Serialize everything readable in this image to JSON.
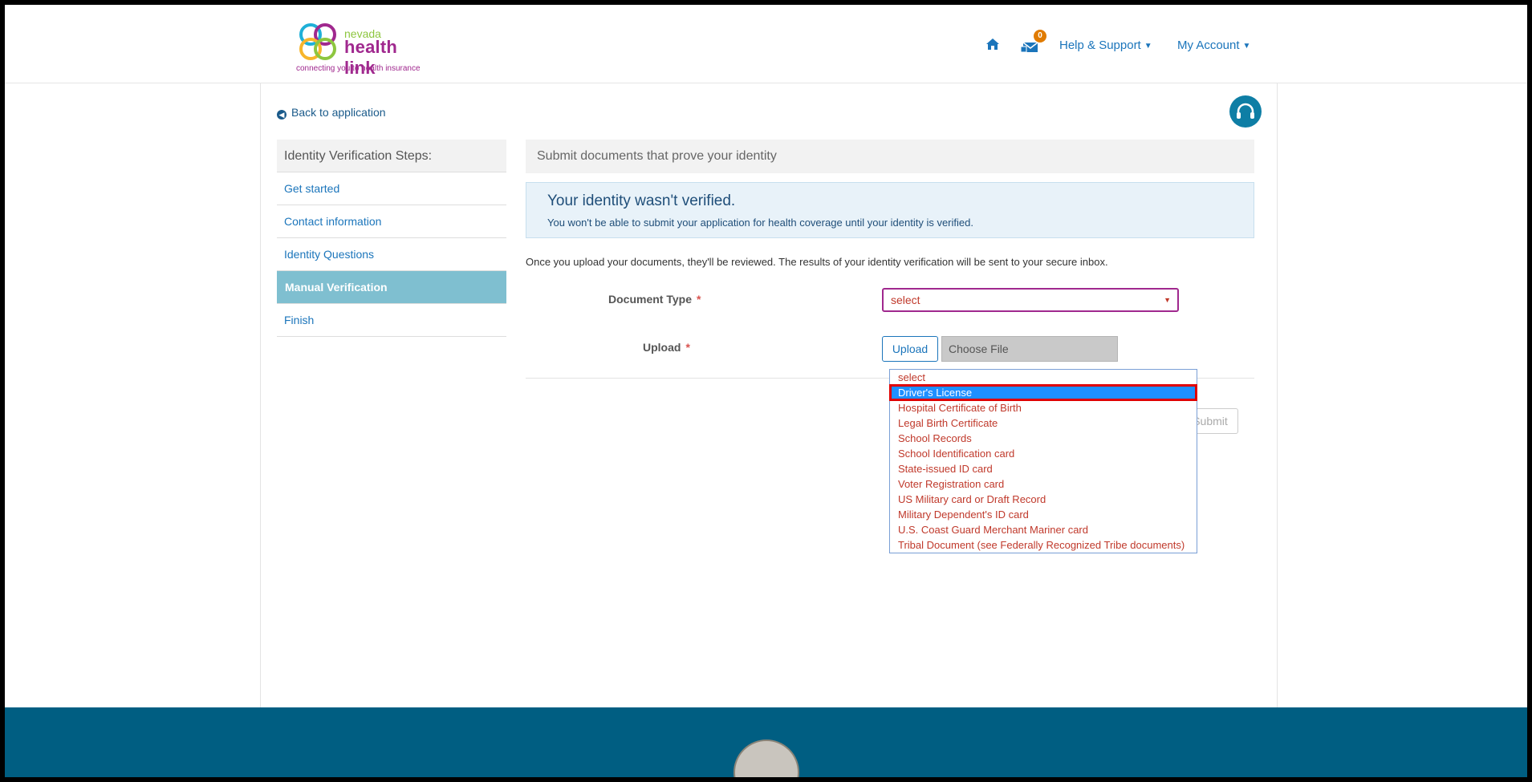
{
  "header": {
    "logo_top": "nevada",
    "logo_main": "health link",
    "logo_tagline": "connecting you to health insurance",
    "mail_count": "0",
    "help_label": "Help & Support",
    "account_label": "My Account"
  },
  "back_link": "Back to application",
  "sidebar": {
    "title": "Identity Verification Steps:",
    "items": [
      {
        "label": "Get started"
      },
      {
        "label": "Contact information"
      },
      {
        "label": "Identity Questions"
      },
      {
        "label": "Manual Verification"
      },
      {
        "label": "Finish"
      }
    ]
  },
  "main": {
    "panel_title": "Submit documents that prove your identity",
    "alert_title": "Your identity wasn't verified.",
    "alert_message": "You won't be able to submit your application for health coverage until your identity is verified.",
    "info_text": "Once you upload your documents, they'll be reviewed. The results of your identity verification will be sent to your secure inbox.",
    "document_type_label": "Document Type",
    "document_type_value": "select",
    "upload_label": "Upload",
    "upload_button": "Upload",
    "choose_file": "Choose File",
    "submit_button": "Submit"
  },
  "dropdown": {
    "options": [
      "select",
      "Driver's License",
      "Hospital Certificate of Birth",
      "Legal Birth Certificate",
      "School Records",
      "School Identification card",
      "State-issued ID card",
      "Voter Registration card",
      "US Military card or Draft Record",
      "Military Dependent's ID card",
      "U.S. Coast Guard Merchant Mariner card",
      "Tribal Document (see Federally Recognized Tribe documents)"
    ],
    "highlighted": "Driver's License"
  },
  "colors": {
    "brand_purple": "#a0288e",
    "link_blue": "#1b75bb",
    "active_step": "#7fbfd0",
    "footer": "#005e82",
    "highlight": "#1e90ff"
  }
}
